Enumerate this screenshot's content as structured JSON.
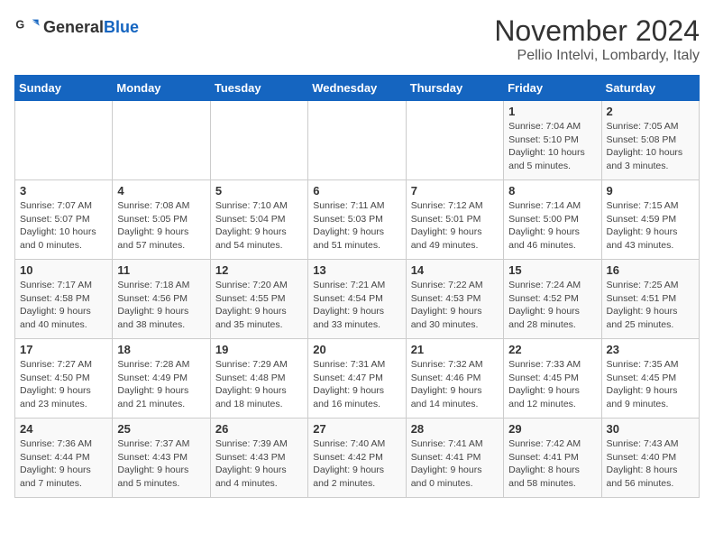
{
  "header": {
    "logo_general": "General",
    "logo_blue": "Blue",
    "month": "November 2024",
    "location": "Pellio Intelvi, Lombardy, Italy"
  },
  "weekdays": [
    "Sunday",
    "Monday",
    "Tuesday",
    "Wednesday",
    "Thursday",
    "Friday",
    "Saturday"
  ],
  "weeks": [
    [
      {
        "day": "",
        "info": ""
      },
      {
        "day": "",
        "info": ""
      },
      {
        "day": "",
        "info": ""
      },
      {
        "day": "",
        "info": ""
      },
      {
        "day": "",
        "info": ""
      },
      {
        "day": "1",
        "info": "Sunrise: 7:04 AM\nSunset: 5:10 PM\nDaylight: 10 hours\nand 5 minutes."
      },
      {
        "day": "2",
        "info": "Sunrise: 7:05 AM\nSunset: 5:08 PM\nDaylight: 10 hours\nand 3 minutes."
      }
    ],
    [
      {
        "day": "3",
        "info": "Sunrise: 7:07 AM\nSunset: 5:07 PM\nDaylight: 10 hours\nand 0 minutes."
      },
      {
        "day": "4",
        "info": "Sunrise: 7:08 AM\nSunset: 5:05 PM\nDaylight: 9 hours\nand 57 minutes."
      },
      {
        "day": "5",
        "info": "Sunrise: 7:10 AM\nSunset: 5:04 PM\nDaylight: 9 hours\nand 54 minutes."
      },
      {
        "day": "6",
        "info": "Sunrise: 7:11 AM\nSunset: 5:03 PM\nDaylight: 9 hours\nand 51 minutes."
      },
      {
        "day": "7",
        "info": "Sunrise: 7:12 AM\nSunset: 5:01 PM\nDaylight: 9 hours\nand 49 minutes."
      },
      {
        "day": "8",
        "info": "Sunrise: 7:14 AM\nSunset: 5:00 PM\nDaylight: 9 hours\nand 46 minutes."
      },
      {
        "day": "9",
        "info": "Sunrise: 7:15 AM\nSunset: 4:59 PM\nDaylight: 9 hours\nand 43 minutes."
      }
    ],
    [
      {
        "day": "10",
        "info": "Sunrise: 7:17 AM\nSunset: 4:58 PM\nDaylight: 9 hours\nand 40 minutes."
      },
      {
        "day": "11",
        "info": "Sunrise: 7:18 AM\nSunset: 4:56 PM\nDaylight: 9 hours\nand 38 minutes."
      },
      {
        "day": "12",
        "info": "Sunrise: 7:20 AM\nSunset: 4:55 PM\nDaylight: 9 hours\nand 35 minutes."
      },
      {
        "day": "13",
        "info": "Sunrise: 7:21 AM\nSunset: 4:54 PM\nDaylight: 9 hours\nand 33 minutes."
      },
      {
        "day": "14",
        "info": "Sunrise: 7:22 AM\nSunset: 4:53 PM\nDaylight: 9 hours\nand 30 minutes."
      },
      {
        "day": "15",
        "info": "Sunrise: 7:24 AM\nSunset: 4:52 PM\nDaylight: 9 hours\nand 28 minutes."
      },
      {
        "day": "16",
        "info": "Sunrise: 7:25 AM\nSunset: 4:51 PM\nDaylight: 9 hours\nand 25 minutes."
      }
    ],
    [
      {
        "day": "17",
        "info": "Sunrise: 7:27 AM\nSunset: 4:50 PM\nDaylight: 9 hours\nand 23 minutes."
      },
      {
        "day": "18",
        "info": "Sunrise: 7:28 AM\nSunset: 4:49 PM\nDaylight: 9 hours\nand 21 minutes."
      },
      {
        "day": "19",
        "info": "Sunrise: 7:29 AM\nSunset: 4:48 PM\nDaylight: 9 hours\nand 18 minutes."
      },
      {
        "day": "20",
        "info": "Sunrise: 7:31 AM\nSunset: 4:47 PM\nDaylight: 9 hours\nand 16 minutes."
      },
      {
        "day": "21",
        "info": "Sunrise: 7:32 AM\nSunset: 4:46 PM\nDaylight: 9 hours\nand 14 minutes."
      },
      {
        "day": "22",
        "info": "Sunrise: 7:33 AM\nSunset: 4:45 PM\nDaylight: 9 hours\nand 12 minutes."
      },
      {
        "day": "23",
        "info": "Sunrise: 7:35 AM\nSunset: 4:45 PM\nDaylight: 9 hours\nand 9 minutes."
      }
    ],
    [
      {
        "day": "24",
        "info": "Sunrise: 7:36 AM\nSunset: 4:44 PM\nDaylight: 9 hours\nand 7 minutes."
      },
      {
        "day": "25",
        "info": "Sunrise: 7:37 AM\nSunset: 4:43 PM\nDaylight: 9 hours\nand 5 minutes."
      },
      {
        "day": "26",
        "info": "Sunrise: 7:39 AM\nSunset: 4:43 PM\nDaylight: 9 hours\nand 4 minutes."
      },
      {
        "day": "27",
        "info": "Sunrise: 7:40 AM\nSunset: 4:42 PM\nDaylight: 9 hours\nand 2 minutes."
      },
      {
        "day": "28",
        "info": "Sunrise: 7:41 AM\nSunset: 4:41 PM\nDaylight: 9 hours\nand 0 minutes."
      },
      {
        "day": "29",
        "info": "Sunrise: 7:42 AM\nSunset: 4:41 PM\nDaylight: 8 hours\nand 58 minutes."
      },
      {
        "day": "30",
        "info": "Sunrise: 7:43 AM\nSunset: 4:40 PM\nDaylight: 8 hours\nand 56 minutes."
      }
    ]
  ]
}
